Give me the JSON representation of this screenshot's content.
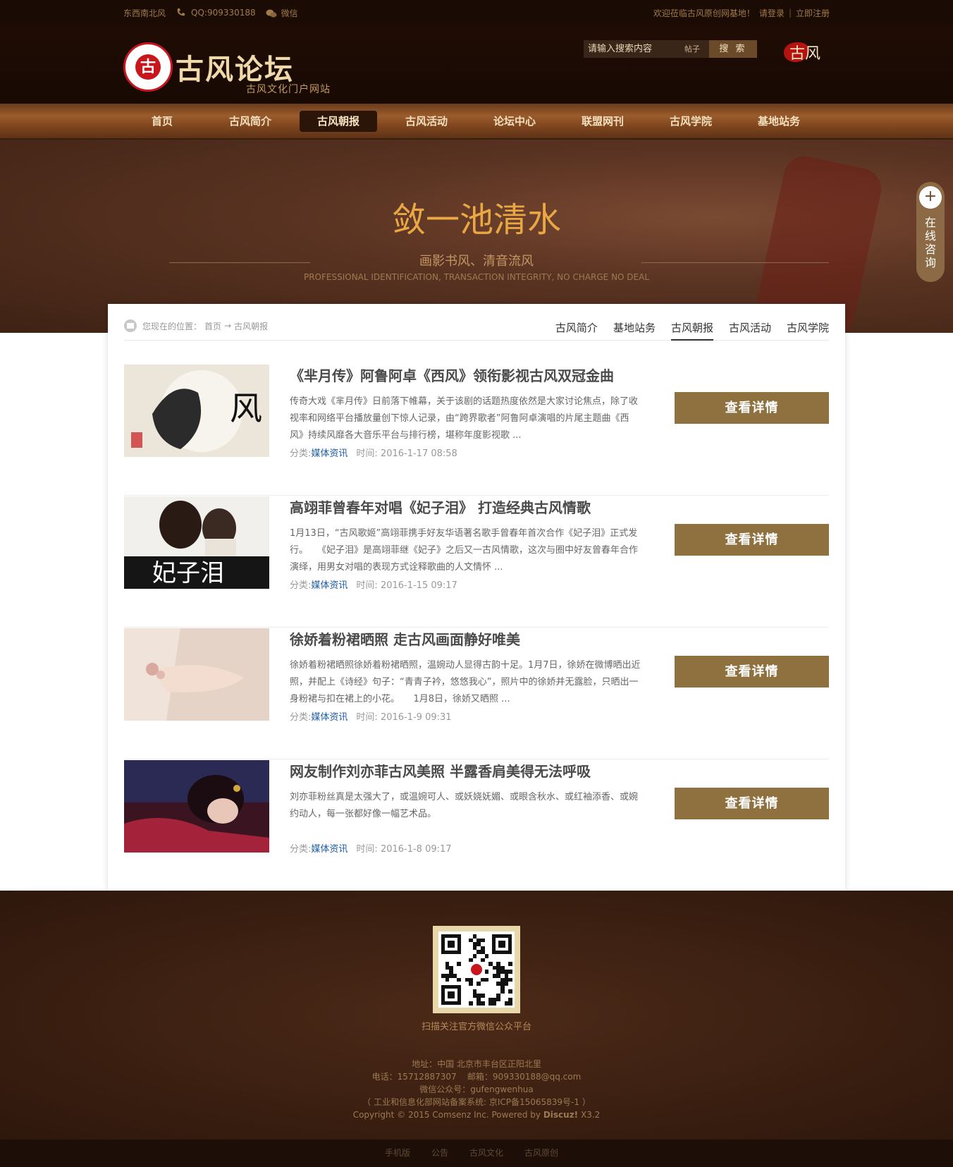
{
  "topbar": {
    "site_tag": "东西南北风",
    "qq": "QQ:909330188",
    "wechat": "微信",
    "welcome": "欢迎莅临古风原创网基地！",
    "login": "请登录",
    "separator": "|",
    "register": "立即注册",
    "phone_icon": "phone-icon",
    "wechat_icon": "wechat-icon"
  },
  "header": {
    "logo_name": "古风论坛",
    "logo_sub": "古风文化门户网站",
    "seal_char": "古",
    "search_placeholder": "请输入搜索内容",
    "search_type": "帖子",
    "search_button": "搜 索",
    "brand_small": "古风"
  },
  "nav": {
    "items": [
      "首页",
      "古风简介",
      "古风朝报",
      "古风活动",
      "论坛中心",
      "联盟网刊",
      "古风学院",
      "基地站务"
    ],
    "active": "古风朝报"
  },
  "banner": {
    "title": "敛一池清水",
    "subtitle": "画影书风、清音流风",
    "english": "PROFESSIONAL IDENTIFICATION, TRANSACTION INTEGRITY, NO CHARGE NO DEAL"
  },
  "consult": {
    "plus": "+",
    "label": "在线咨询"
  },
  "breadcrumb": {
    "prefix": "您现在的位置：",
    "home": "首页",
    "arrow": "→",
    "current": "古风朝报"
  },
  "tabs": [
    "古风简介",
    "基地站务",
    "古风朝报",
    "古风活动",
    "古风学院"
  ],
  "active_tab": "古风朝报",
  "articles": [
    {
      "title": "《芈月传》阿鲁阿卓《西风》领衔影视古风双冠金曲",
      "desc": "传奇大戏《芈月传》日前落下帷幕，关于该剧的话题热度依然是大家讨论焦点，除了收视率和网络平台播放量创下惊人记录，由“跨界歌者”阿鲁阿卓演唱的片尾主题曲《西风》持续风靡各大音乐平台与排行榜，堪称年度影视歌 ...",
      "cat_label": "分类:",
      "category": "媒体资讯",
      "time_label": "时间:",
      "time": "2016-1-17 08:58",
      "button": "查看详情"
    },
    {
      "title": "高翊菲曾春年对唱《妃子泪》 打造经典古风情歌",
      "desc": "1月13日，“古风歌姬”高翊菲携手好友华语著名歌手曾春年首次合作《妃子泪》正式发行。　　《妃子泪》是高翊菲继《妃子》之后又一古风情歌，这次与圈中好友曾春年合作演绎，用男女对唱的表现方式诠释歌曲的人文情怀 ...",
      "cat_label": "分类:",
      "category": "媒体资讯",
      "time_label": "时间:",
      "time": "2016-1-15 09:17",
      "button": "查看详情"
    },
    {
      "title": "徐娇着粉裙晒照 走古风画面静好唯美",
      "desc": "徐娇着粉裙晒照徐娇着粉裙晒照，温婉动人显得古韵十足。1月7日，徐娇在微博晒出近照，并配上《诗经》句子：“青青子衿，悠悠我心”，照片中的徐娇并无露脸，只晒出一身粉裙与扣在裙上的小花。　　1月8日，徐娇又晒照 ...",
      "cat_label": "分类:",
      "category": "媒体资讯",
      "time_label": "时间:",
      "time": "2016-1-9 09:31",
      "button": "查看详情"
    },
    {
      "title": "网友制作刘亦菲古风美照 半露香肩美得无法呼吸",
      "desc": "刘亦菲粉丝真是太强大了，或温婉可人、或妖娆妩媚、或眼含秋水、或红袖添香、或婉约动人，每一张都好像一幅艺术品。",
      "cat_label": "分类:",
      "category": "媒体资讯",
      "time_label": "时间:",
      "time": "2016-1-8 09:17",
      "button": "查看详情"
    }
  ],
  "footer": {
    "scan": "扫描关注官方微信公众平台",
    "address": "地址：中国 北京市丰台区正阳北里",
    "phone": "电话：15712887307",
    "email": "邮箱：909330188@qq.com",
    "wechat": "微信公众号：gufengwenhua",
    "icp": "（ 工业和信息化部网站备案系统: 京ICP备15065839号-1 ）",
    "copyright": "Copyright © 2015 Comsenz Inc. Powered by",
    "powered": "Discuz!",
    "version": "X3.2",
    "links": [
      "手机版",
      "公告",
      "古风文化",
      "古风原创"
    ]
  },
  "colors": {
    "accent": "#8f703f",
    "banner_title": "#e9a844",
    "link": "#1b5aa5",
    "nav_active_bg": "#2b1408"
  }
}
